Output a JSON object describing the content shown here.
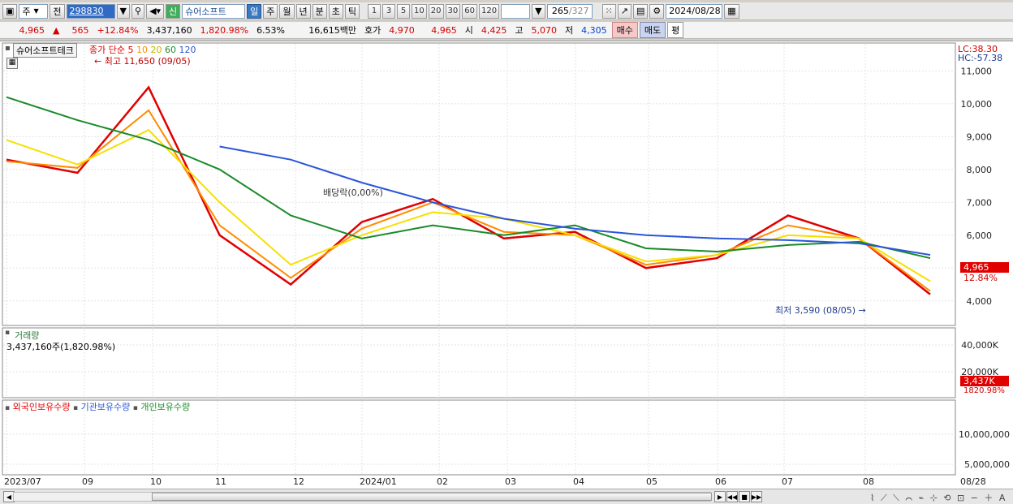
{
  "toolbar": {
    "period": "주",
    "prev": "전",
    "code": "298830",
    "new_badge": "신",
    "stock_name": "슈어소프트",
    "intervals": [
      "일",
      "주",
      "월",
      "년",
      "분",
      "초",
      "틱"
    ],
    "selected_interval": "일",
    "nums": [
      "1",
      "3",
      "5",
      "10",
      "20",
      "30",
      "60",
      "120"
    ],
    "count": "265",
    "total": "/327",
    "date": "2024/08/28"
  },
  "quote": {
    "price": "4,965",
    "arrow": "▲",
    "change": "565",
    "rate": "+12.84%",
    "volume": "3,437,160",
    "vol_rate": "1,820.98%",
    "turnover": "6.53%",
    "amount": "16,615백만",
    "hoga_label": "호가",
    "ask": "4,970",
    "bid": "4,965",
    "open_label": "시",
    "open": "4,425",
    "high_label": "고",
    "high": "5,070",
    "low_label": "저",
    "low": "4,305",
    "buy": "매수",
    "sell": "매도",
    "eval": "평"
  },
  "price_panel": {
    "title": "슈어소프트테크",
    "ma_label": "종가 단순",
    "ma_periods": [
      "5",
      "10",
      "20",
      "60",
      "120"
    ],
    "ma_colors": [
      "#e00000",
      "#ff8c00",
      "#f5e000",
      "#1a8a2a",
      "#2b55d8"
    ],
    "high_marker": "최고 11,650 (09/05)",
    "low_marker": "최저 3,590 (08/05)",
    "dividend": "배당락(0,00%)",
    "lc": "LC:38.30",
    "hc": "HC:-57.38",
    "price_ticks": [
      "11,000",
      "10,000",
      "9,000",
      "8,000",
      "7,000",
      "6,000",
      "5,000",
      "4,000"
    ],
    "current_price": "4,965",
    "current_rate": "12.84%"
  },
  "volume_panel": {
    "title": "거래량",
    "value": "3,437,160주(1,820.98%)",
    "ticks": [
      "40,000K",
      "20,000K"
    ],
    "current": "3,437K",
    "current_rate": "1820.98%"
  },
  "holdings_panel": {
    "series": [
      "외국인보유수량",
      "기관보유수량",
      "개인보유수량"
    ],
    "series_colors": [
      "#e00000",
      "#2b55d8",
      "#1a8a2a"
    ],
    "ticks": [
      "10,000,000",
      "5,000,000"
    ]
  },
  "x_axis": [
    "2023/07",
    "09",
    "10",
    "11",
    "12",
    "2024/01",
    "02",
    "03",
    "04",
    "05",
    "06",
    "07",
    "08",
    "08/28"
  ],
  "chart_data": {
    "type": "line",
    "x": [
      "2023/07",
      "2023/08",
      "2023/09",
      "2023/10",
      "2023/11",
      "2023/12",
      "2024/01",
      "2024/02",
      "2024/03",
      "2024/04",
      "2024/05",
      "2024/06",
      "2024/07",
      "2024/08"
    ],
    "series": [
      {
        "name": "5",
        "values": [
          8300,
          7900,
          10500,
          6000,
          4500,
          6400,
          7100,
          5900,
          6100,
          5000,
          5300,
          6600,
          5900,
          4200
        ]
      },
      {
        "name": "10",
        "values": [
          8250,
          8050,
          9800,
          6300,
          4700,
          6200,
          7000,
          6100,
          6000,
          5100,
          5400,
          6300,
          5900,
          4300
        ]
      },
      {
        "name": "20",
        "values": [
          8900,
          8150,
          9200,
          7000,
          5100,
          6000,
          6700,
          6500,
          6000,
          5200,
          5400,
          6000,
          5900,
          4600
        ]
      },
      {
        "name": "60",
        "values": [
          10200,
          9500,
          8900,
          8000,
          6600,
          5900,
          6300,
          6000,
          6300,
          5600,
          5500,
          5700,
          5800,
          5300
        ]
      },
      {
        "name": "120",
        "values": [
          null,
          null,
          null,
          8700,
          8300,
          7600,
          7000,
          6500,
          6200,
          6000,
          5900,
          5850,
          5750,
          5400
        ]
      }
    ],
    "ylim": [
      3500,
      11700
    ]
  }
}
